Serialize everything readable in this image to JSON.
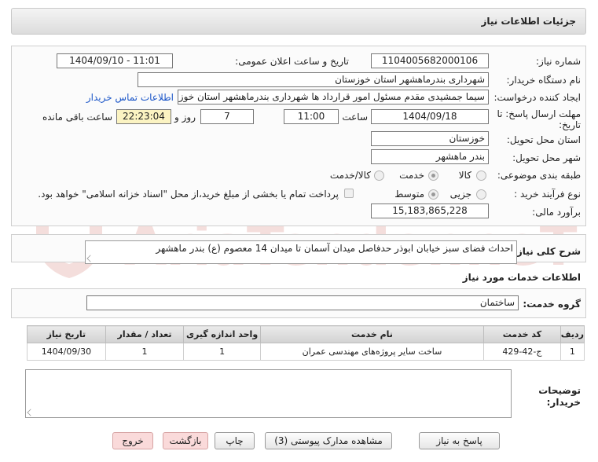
{
  "header": {
    "title": "جزئیات اطلاعات نیاز"
  },
  "form": {
    "need_number_label": "شماره نیاز:",
    "need_number": "1104005682000106",
    "announce_label": "تاریخ و ساعت اعلان عمومی:",
    "announce_value": "1404/09/10 - 11:01",
    "buyer_org_label": "نام دستگاه خریدار:",
    "buyer_org": "شهرداری بندرماهشهر استان خوزستان",
    "creator_label": "ایجاد کننده درخواست:",
    "creator": "سیما جمشیدی مقدم مسئول امور قرارداد ها شهرداری بندرماهشهر استان خوزستان",
    "contact_link": "اطلاعات تماس خریدار",
    "deadline_label_line1": "مهلت ارسال پاسخ: تا",
    "deadline_label_line2": "تاریخ:",
    "deadline_date": "1404/09/18",
    "time_label": "ساعت",
    "deadline_time": "11:00",
    "days_value": "7",
    "days_label": "روز و",
    "remaining_time": "22:23:04",
    "remaining_label": "ساعت باقی مانده",
    "province_label": "استان محل تحویل:",
    "province": "خوزستان",
    "city_label": "شهر محل تحویل:",
    "city": "بندر ماهشهر",
    "category_label": "طبقه بندی موضوعی:",
    "category_options": [
      "کالا",
      "خدمت",
      "کالا/خدمت"
    ],
    "category_selected": "خدمت",
    "process_label": "نوع فرآیند خرید :",
    "process_options": [
      "جزیی",
      "متوسط"
    ],
    "process_selected": "متوسط",
    "payment_note": "پرداخت تمام یا بخشی از مبلغ خرید،از محل \"اسناد خزانه اسلامی\" خواهد بود.",
    "estimate_label": "برآورد مالی:",
    "estimate": "15,183,865,228"
  },
  "description": {
    "label": "شرح کلی نیاز:",
    "text": "احداث فضای سبز خیابان ابوذر حدفاصل میدان آسمان تا میدان 14 معصوم (ع) بندر ماهشهر"
  },
  "services": {
    "section_title": "اطلاعات خدمات مورد نیاز",
    "group_label": "گروه خدمت:",
    "group_value": "ساختمان",
    "table": {
      "headers": [
        "ردیف",
        "کد خدمت",
        "نام خدمت",
        "واحد اندازه گیری",
        "تعداد / مقدار",
        "تاریخ نیاز"
      ],
      "rows": [
        [
          "1",
          "ج-42-429",
          "ساخت سایر پروژه‌های مهندسی عمران",
          "1",
          "1",
          "1404/09/30"
        ]
      ]
    }
  },
  "buyer_notes": {
    "label_line1": "توضیحات",
    "label_line2": "خریدار:"
  },
  "buttons": {
    "reply": "پاسخ به نیاز",
    "attachments": "مشاهده مدارک پیوستی (3)",
    "print": "چاپ",
    "back": "بازگشت",
    "exit": "خروج"
  },
  "watermark": {
    "text": "AriaTender.neT"
  }
}
